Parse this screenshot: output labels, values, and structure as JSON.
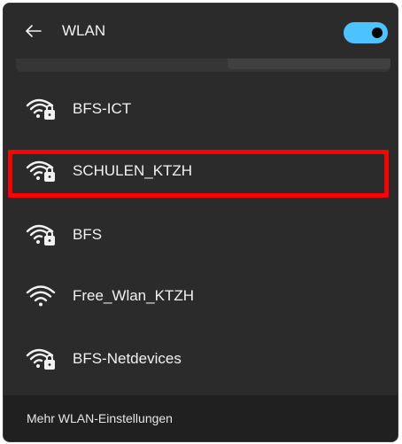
{
  "header": {
    "back_icon": "arrow-left-icon",
    "title": "WLAN",
    "toggle": {
      "state": "on",
      "color": "#4cc2ff"
    }
  },
  "networks": [
    {
      "name": "BFS-ICT",
      "secured": true
    },
    {
      "name": "SCHULEN_KTZH",
      "secured": true,
      "highlighted": true
    },
    {
      "name": "BFS",
      "secured": true
    },
    {
      "name": "Free_Wlan_KTZH",
      "secured": false
    },
    {
      "name": "BFS-Netdevices",
      "secured": true
    }
  ],
  "footer": {
    "more_settings": "Mehr WLAN-Einstellungen"
  },
  "colors": {
    "panel_bg": "#2b2b2b",
    "footer_bg": "#202020",
    "text": "#f2f2f2",
    "accent": "#4cc2ff",
    "highlight_border": "#ff0000"
  }
}
